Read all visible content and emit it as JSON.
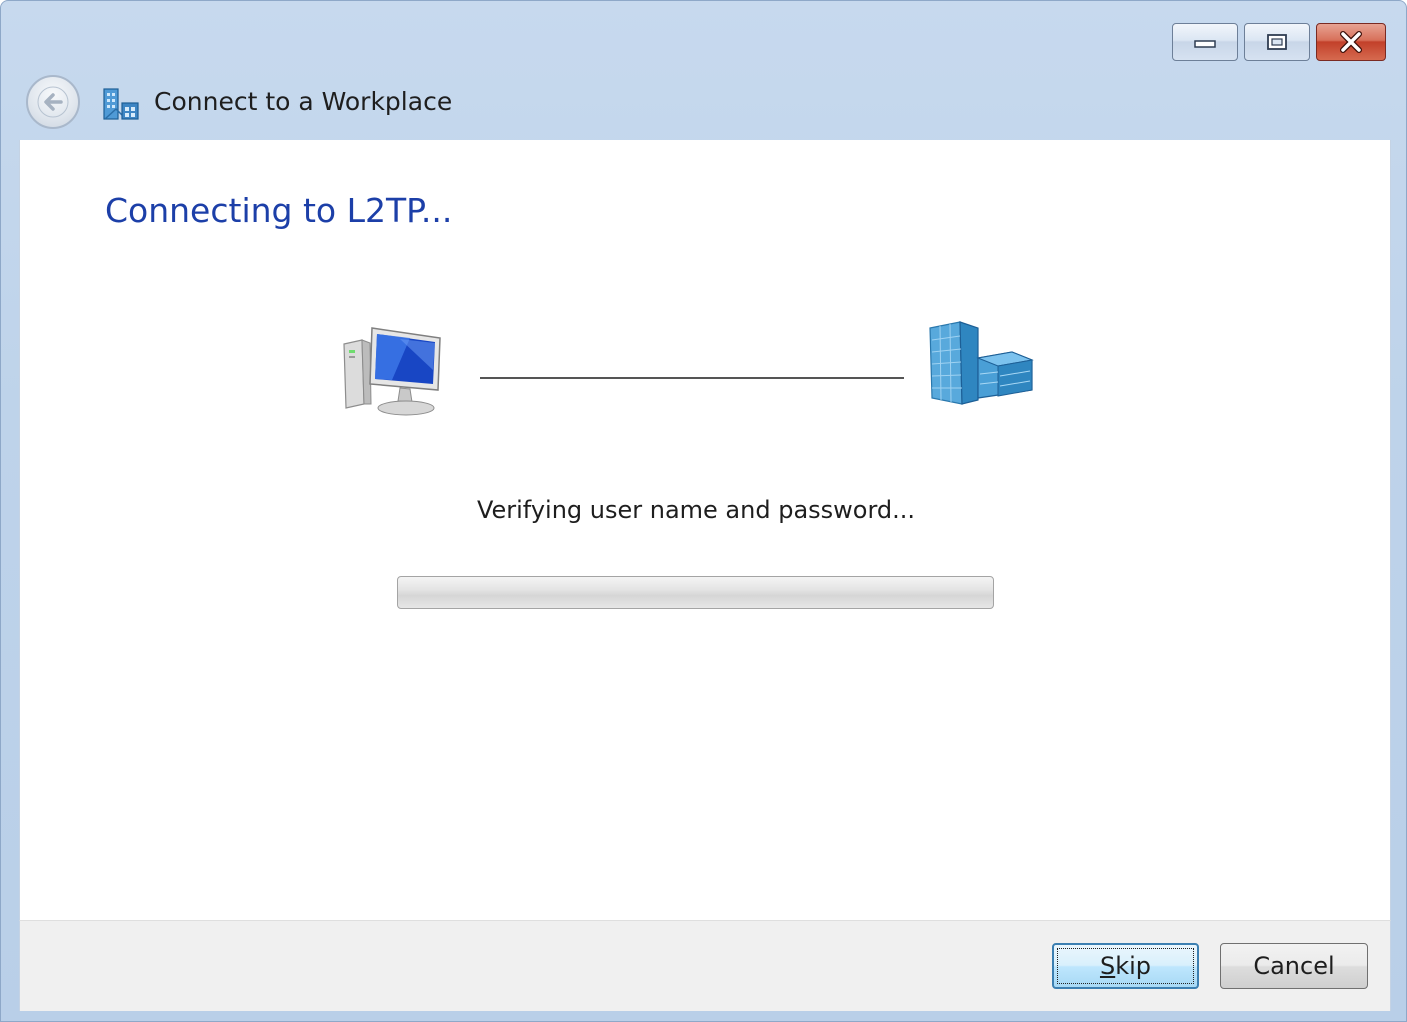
{
  "window": {
    "title": "Connect to a Workplace",
    "caption_buttons": [
      "minimize",
      "maximize",
      "close"
    ]
  },
  "header": {
    "back_icon": "back-arrow-icon",
    "app_icon": "workplace-network-icon"
  },
  "content": {
    "heading": "Connecting to L2TP...",
    "local_icon": "computer-icon",
    "remote_icon": "office-building-icon",
    "status": "Verifying user name and password...",
    "progress_percent": 0
  },
  "footer": {
    "skip_label_accel": "S",
    "skip_label_rest": "kip",
    "cancel_label": "Cancel"
  },
  "colors": {
    "heading": "#1c3fa8",
    "close_button": "#c2402a",
    "frame": "#bed3ea"
  }
}
